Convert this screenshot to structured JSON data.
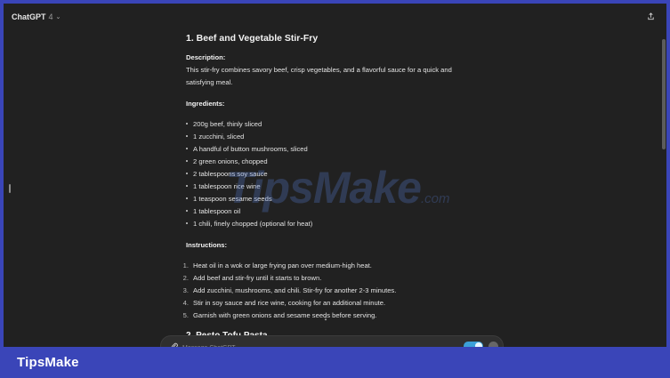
{
  "header": {
    "title": "ChatGPT",
    "version": "4"
  },
  "message": {
    "heading": "1. Beef and Vegetable Stir-Fry",
    "description_label": "Description:",
    "description": "This stir-fry combines savory beef, crisp vegetables, and a flavorful sauce for a quick and satisfying meal.",
    "ingredients_label": "Ingredients:",
    "ingredients": [
      "200g beef, thinly sliced",
      "1 zucchini, sliced",
      "A handful of button mushrooms, sliced",
      "2 green onions, chopped",
      "2 tablespoons soy sauce",
      "1 tablespoon rice wine",
      "1 teaspoon sesame seeds",
      "1 tablespoon oil",
      "1 chili, finely chopped (optional for heat)"
    ],
    "instructions_label": "Instructions:",
    "instructions": [
      {
        "num": "1.",
        "text": "Heat oil in a wok or large frying pan over medium-high heat."
      },
      {
        "num": "2.",
        "text": "Add beef and stir-fry until it starts to brown."
      },
      {
        "num": "3.",
        "text": "Add zucchini, mushrooms, and chili. Stir-fry for another 2-3 minutes."
      },
      {
        "num": "4.",
        "text": "Stir in soy sauce and rice wine, cooking for an additional minute."
      },
      {
        "num": "5.",
        "text": "Garnish with green onions and sesame seeds before serving."
      }
    ],
    "next_heading": "2. Pesto Tofu Pasta"
  },
  "composer": {
    "placeholder": "Message ChatGPT"
  },
  "watermark": {
    "main": "TipsMake",
    "suffix": ".com"
  },
  "footer": {
    "brand": "TipsMake"
  },
  "colors": {
    "background": "#212121",
    "frame": "#3a45b8",
    "accent": "#3ca0d8"
  }
}
